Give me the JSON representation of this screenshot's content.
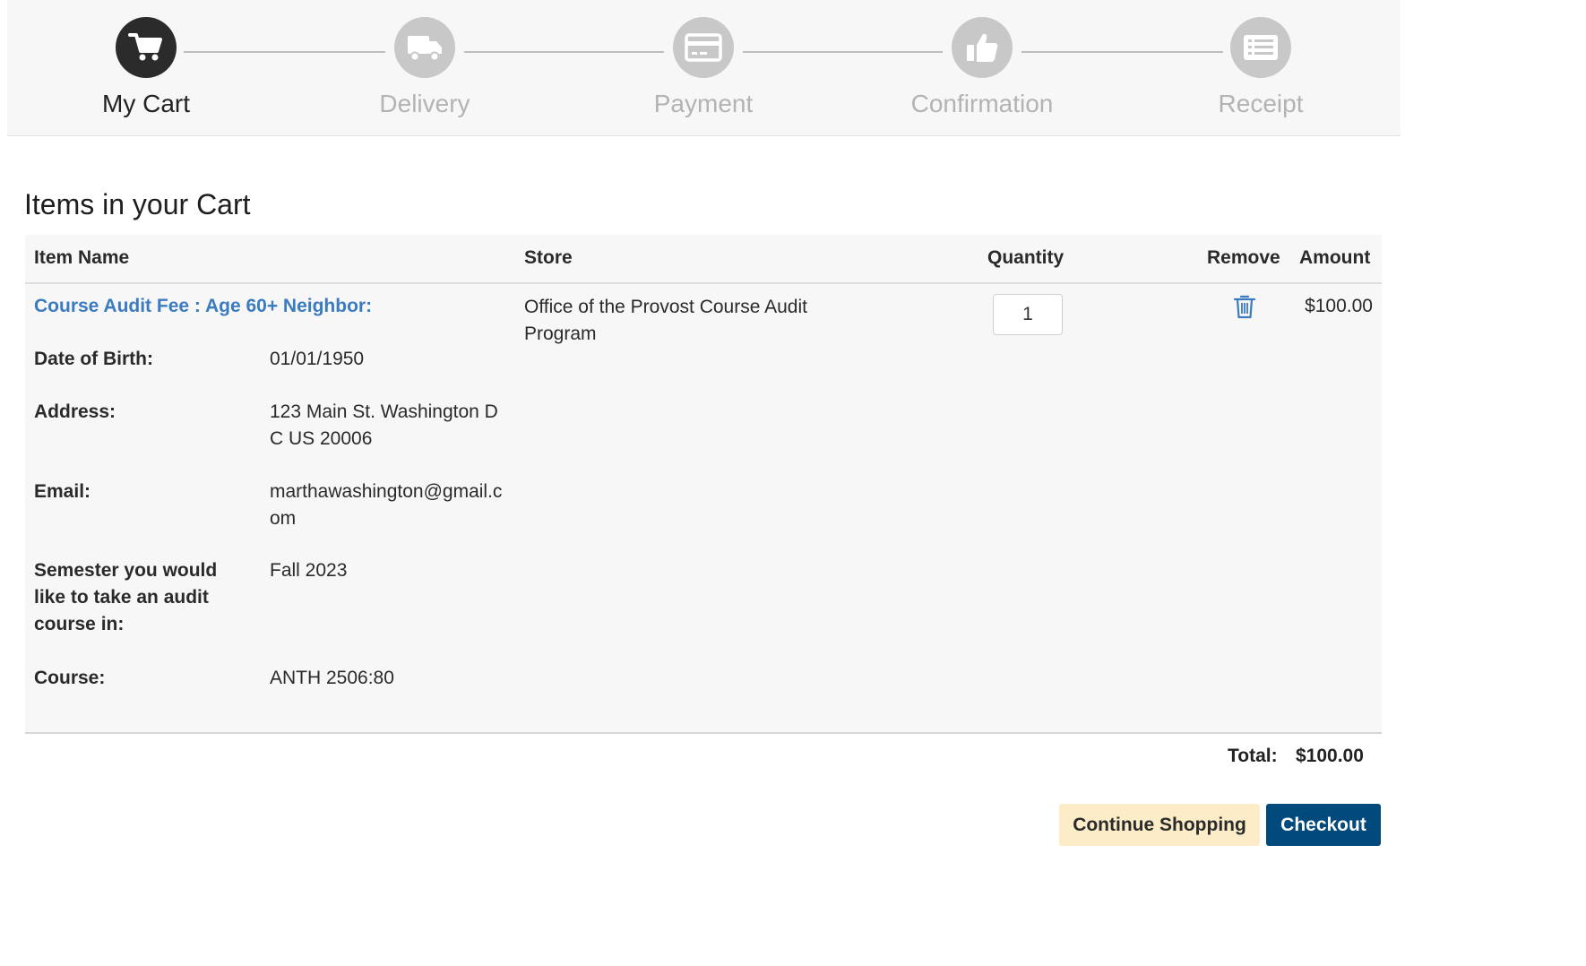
{
  "stepper": {
    "steps": [
      {
        "label": "My Cart",
        "icon": "cart-icon",
        "active": true
      },
      {
        "label": "Delivery",
        "icon": "truck-icon",
        "active": false
      },
      {
        "label": "Payment",
        "icon": "credit-card-icon",
        "active": false
      },
      {
        "label": "Confirmation",
        "icon": "thumbs-up-icon",
        "active": false
      },
      {
        "label": "Receipt",
        "icon": "list-icon",
        "active": false
      }
    ]
  },
  "cart": {
    "title": "Items in your Cart",
    "columns": {
      "item_name": "Item Name",
      "store": "Store",
      "quantity": "Quantity",
      "remove": "Remove",
      "amount": "Amount"
    },
    "item": {
      "name": "Course Audit Fee : Age 60+ Neighbor:",
      "details": [
        {
          "label": "Date of Birth:",
          "value": "01/01/1950"
        },
        {
          "label": "Address:",
          "value": "123 Main St. Washington DC US 20006"
        },
        {
          "label": "Email:",
          "value": "marthawashington@gmail.com"
        },
        {
          "label": "Semester you would like to take an audit course in:",
          "value": "Fall 2023"
        },
        {
          "label": "Course:",
          "value": "ANTH 2506:80"
        }
      ],
      "store": "Office of the Provost Course Audit Program",
      "quantity": "1",
      "remove_icon": "trash-icon",
      "amount": "$100.00"
    },
    "total_label": "Total:",
    "total_value": "$100.00"
  },
  "actions": {
    "continue_label": "Continue Shopping",
    "checkout_label": "Checkout"
  },
  "colors": {
    "accent": "#034a7c",
    "link": "#3b7bbf",
    "continue_bg": "#fcedc8",
    "active_step": "#2b2b2b",
    "inactive_step": "#c8c8c8"
  }
}
